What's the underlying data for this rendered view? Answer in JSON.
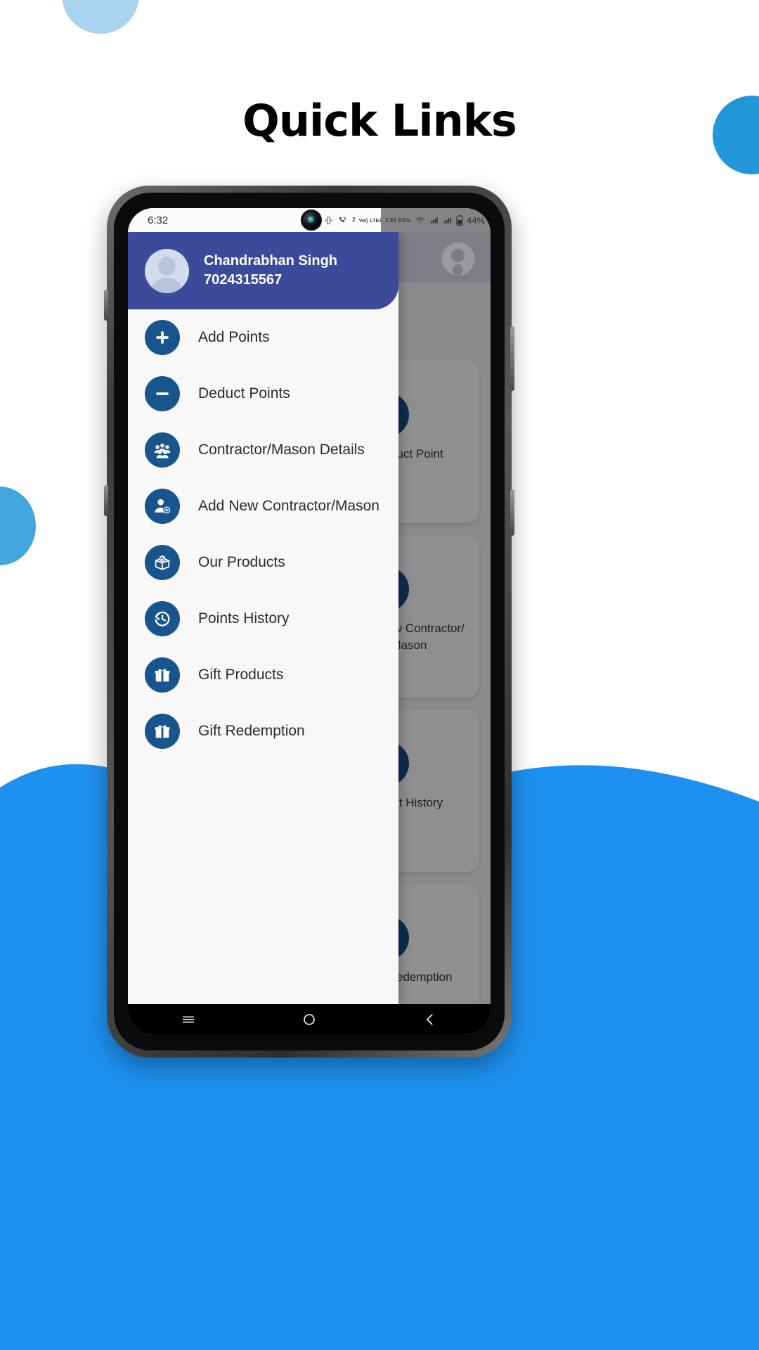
{
  "page": {
    "title": "Quick Links",
    "accent_blue": "#1e90f0",
    "drawer_header_color": "#3c4a9b",
    "icon_circle_color": "#18558c"
  },
  "status_bar": {
    "time": "6:32",
    "data_rate_value": "2.93",
    "data_rate_unit": "KB/s",
    "sim_count": "2",
    "volte_top": "VoI)",
    "volte_bottom": "LTE1",
    "battery": "44%",
    "icons": [
      "vibrate-icon",
      "call-signal-icon",
      "volte-icon",
      "data-speed-icon",
      "wifi-icon",
      "signal-icon",
      "signal-icon-2",
      "battery-icon"
    ]
  },
  "drawer": {
    "user": {
      "name": "Chandrabhan Singh",
      "phone": "7024315567",
      "avatar": "user-avatar"
    },
    "items": [
      {
        "label": "Add Points",
        "icon": "plus-circle-icon"
      },
      {
        "label": "Deduct Points",
        "icon": "minus-circle-icon"
      },
      {
        "label": "Contractor/Mason Details",
        "icon": "group-people-icon"
      },
      {
        "label": "Add New Contractor/Mason",
        "icon": "person-add-icon"
      },
      {
        "label": "Our Products",
        "icon": "box-check-icon"
      },
      {
        "label": "Points History",
        "icon": "history-clock-icon"
      },
      {
        "label": "Gift Products",
        "icon": "gift-icon"
      },
      {
        "label": "Gift Redemption",
        "icon": "gift-icon"
      }
    ]
  },
  "background_app": {
    "avatar": "profile-avatar",
    "cards": [
      {
        "label": "Deduct Point",
        "icon": "minus-circle-icon"
      },
      {
        "label": "Add New Contractor/ Mason",
        "icon": "person-add-icon"
      },
      {
        "label": "Point History",
        "icon": "history-clock-icon"
      },
      {
        "label": "Gift Redemption",
        "icon": "gift-icon"
      }
    ]
  },
  "nav_bar": {
    "items": [
      {
        "name": "recents-button",
        "icon": "hamburger-icon"
      },
      {
        "name": "home-button",
        "icon": "circle-icon"
      },
      {
        "name": "back-button",
        "icon": "chevron-left-icon"
      }
    ]
  }
}
